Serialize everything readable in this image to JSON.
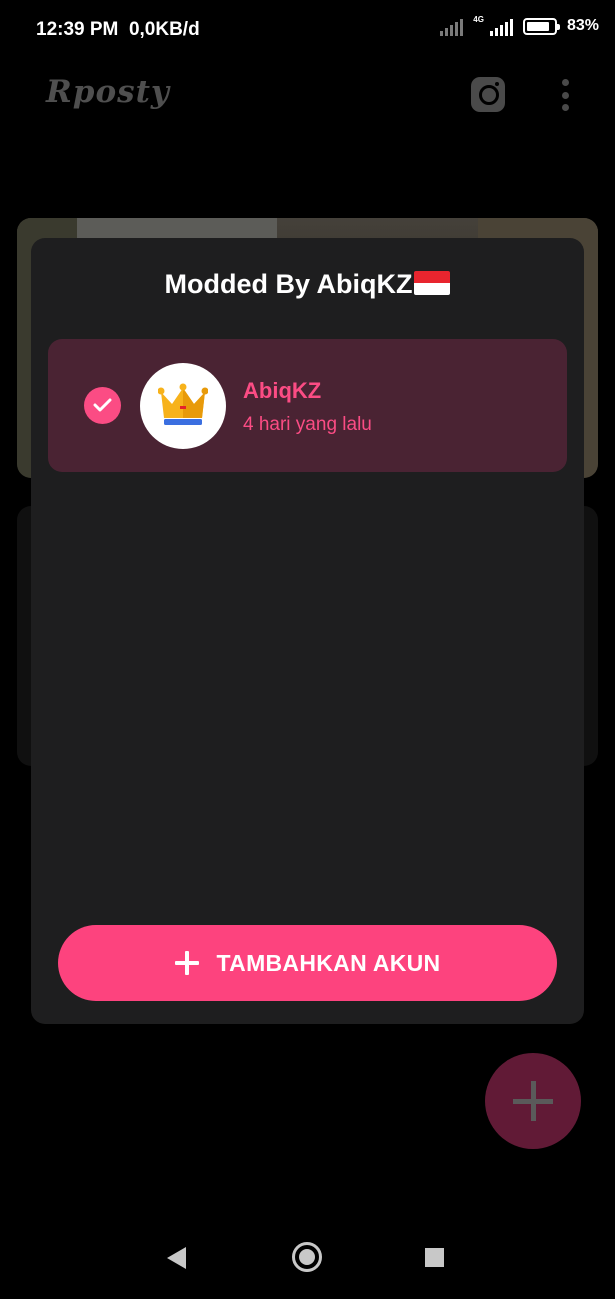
{
  "status_bar": {
    "time": "12:39 PM",
    "speed": "0,0KB/d",
    "network_type": "4G",
    "battery_level": 0.83,
    "battery_text": "83%"
  },
  "toolbar": {
    "app_name": "Rposty",
    "instagram_icon": "instagram-icon",
    "menu_icon": "more-vert-icon"
  },
  "dialog": {
    "title": "Modded By AbiqKZ",
    "title_flag": "indonesia-flag-icon",
    "accounts": [
      {
        "name": "AbiqKZ",
        "time": "4 hari yang lalu",
        "selected": true,
        "avatar_icon": "crown-icon"
      }
    ],
    "add_button_label": "TAMBAHKAN AKUN",
    "add_button_icon": "plus-icon"
  },
  "fab": {
    "icon": "plus-icon"
  },
  "nav_bar": {
    "back": "back-icon",
    "home": "home-icon",
    "recents": "recents-icon"
  },
  "colors": {
    "accent": "#fd437e",
    "selected_row": "#4a2333",
    "dialog_bg": "#1e1e1f"
  }
}
